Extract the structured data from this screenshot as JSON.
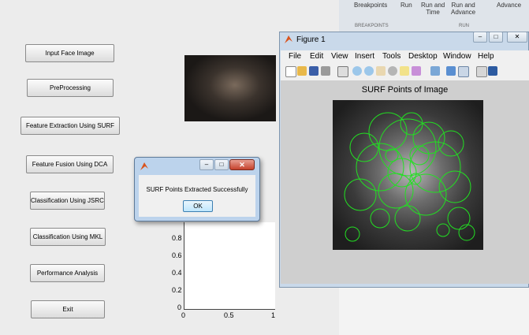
{
  "main_gui": {
    "buttons": [
      {
        "name": "input-face-image-button",
        "label": "Input Face Image"
      },
      {
        "name": "preprocessing-button",
        "label": "PreProcessing"
      },
      {
        "name": "feature-extraction-surf-button",
        "label": "Feature Extraction Using SURF"
      },
      {
        "name": "feature-fusion-dca-button",
        "label": "Feature Fusion Using DCA"
      },
      {
        "name": "classification-jsrc-button",
        "label": "Classification Using JSRC"
      },
      {
        "name": "classification-mkl-button",
        "label": "Classification Using MKL"
      },
      {
        "name": "performance-analysis-button",
        "label": "Performance Analysis"
      },
      {
        "name": "exit-button",
        "label": "Exit"
      }
    ],
    "axes": {
      "y_ticks": [
        "0",
        "0.2",
        "0.4",
        "0.6",
        "0.8"
      ],
      "x_ticks": [
        "0",
        "0.5",
        "1"
      ]
    }
  },
  "ide_ribbon": {
    "breakpoints_label": "Breakpoints",
    "run_label": "Run",
    "run_and_time_label": "Run and\nTime",
    "run_and_advance_label": "Run and\nAdvance",
    "advance_label": "Advance",
    "section_breakpoints": "BREAKPOINTS",
    "section_run": "RUN"
  },
  "figure_window": {
    "title": "Figure 1",
    "menu": [
      "File",
      "Edit",
      "View",
      "Insert",
      "Tools",
      "Desktop",
      "Window",
      "Help"
    ],
    "plot_title": "SURF Points of Image",
    "window_buttons": [
      "minimize-icon",
      "maximize-icon",
      "close-icon"
    ]
  },
  "dialog": {
    "message": "SURF Points Extracted Successfully",
    "ok_label": "OK"
  },
  "colors": {
    "surf_circle": "#22e022",
    "dialog_close": "#c5412c",
    "window_frame": "#c9d9ea"
  }
}
